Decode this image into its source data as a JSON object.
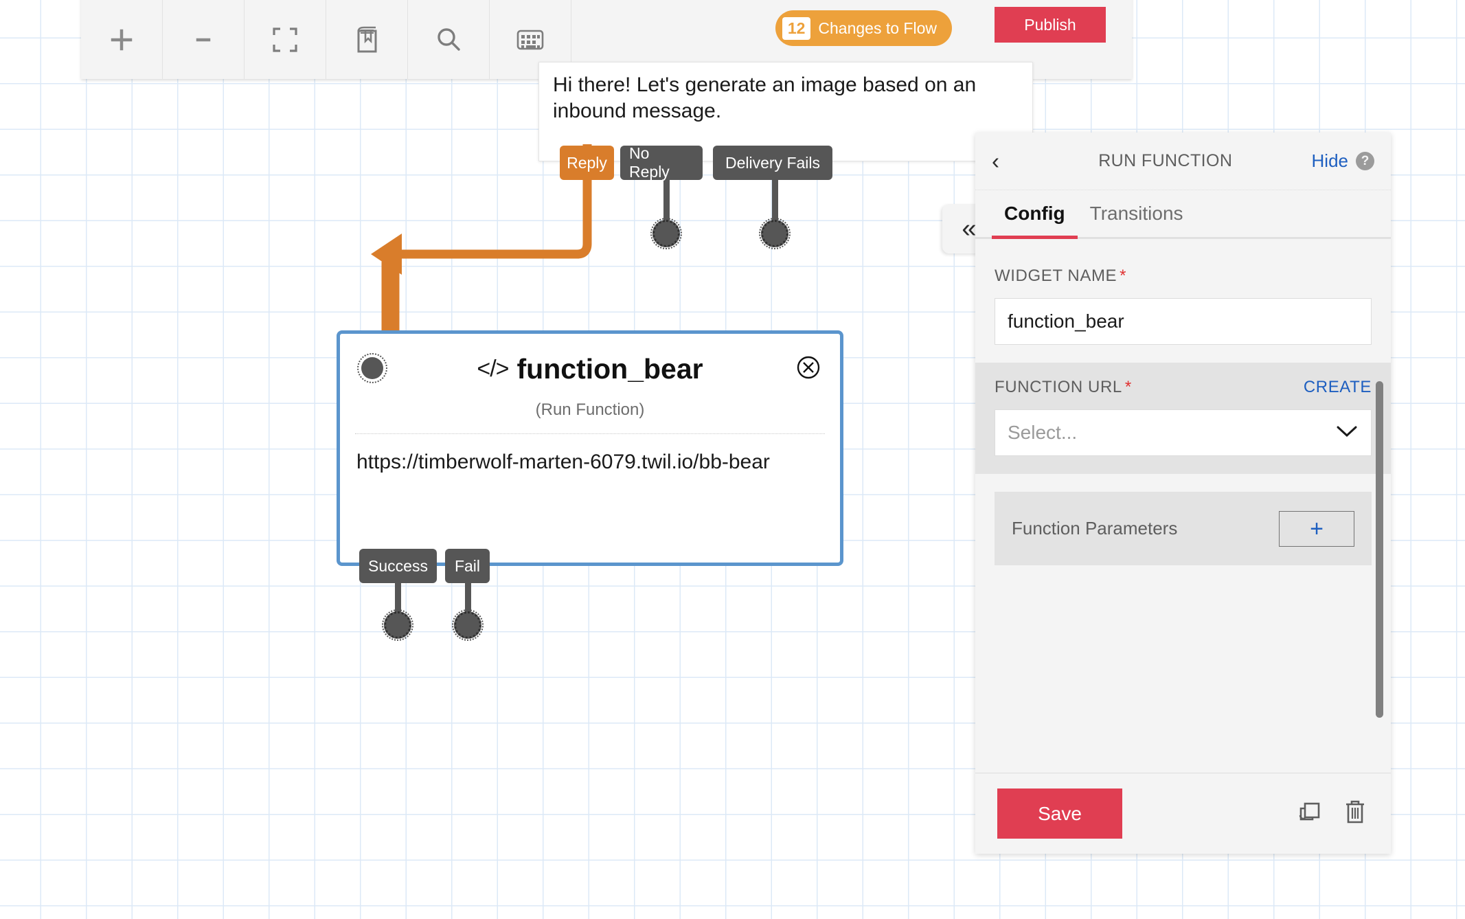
{
  "toolbar": {
    "buttons": [
      {
        "name": "zoom-in",
        "icon": "plus-icon"
      },
      {
        "name": "zoom-out",
        "icon": "minus-icon"
      },
      {
        "name": "fit-to-view",
        "icon": "crop-frame-icon"
      },
      {
        "name": "library",
        "icon": "book-icon"
      },
      {
        "name": "search",
        "icon": "search-icon"
      },
      {
        "name": "keyboard",
        "icon": "keyboard-icon"
      }
    ],
    "changes_count": "12",
    "changes_label": "Changes to Flow",
    "publish_label": "Publish"
  },
  "message_widget": {
    "text": "Hi there! Let's generate an image based on an inbound message.",
    "transitions": [
      {
        "label": "Reply",
        "style": "orange"
      },
      {
        "label": "No Reply",
        "style": "grey"
      },
      {
        "label": "Delivery Fails",
        "style": "grey"
      }
    ]
  },
  "function_node": {
    "code_icon": "</>",
    "title": "function_bear",
    "subtitle": "(Run Function)",
    "url": "https://timberwolf-marten-6079.twil.io/bb-bear",
    "transitions": [
      {
        "label": "Success",
        "style": "grey"
      },
      {
        "label": "Fail",
        "style": "grey"
      }
    ],
    "border_color": "#5b95cd"
  },
  "panel": {
    "collapse_glyph": "«",
    "back_glyph": "‹",
    "title": "RUN FUNCTION",
    "hide_label": "Hide",
    "help_glyph": "?",
    "tabs": [
      {
        "label": "Config",
        "active": true
      },
      {
        "label": "Transitions",
        "active": false
      }
    ],
    "widget_name": {
      "label": "WIDGET NAME",
      "required": "*",
      "value": "function_bear"
    },
    "function_url": {
      "label": "FUNCTION URL",
      "required": "*",
      "action_label": "CREATE",
      "placeholder": "Select...",
      "chevron": "chevron-down-icon"
    },
    "function_parameters": {
      "label": "Function Parameters",
      "add_glyph": "+"
    },
    "footer": {
      "save_label": "Save",
      "duplicate_icon": "duplicate-icon",
      "delete_icon": "trash-icon"
    }
  },
  "colors": {
    "accent_red": "#e03e52",
    "accent_orange": "#eda13b",
    "transition_orange": "#d97d2b",
    "transition_grey": "#565656",
    "node_blue": "#5b95cd",
    "link_blue": "#1e5fc0",
    "grid_blue": "#dce9f7"
  }
}
